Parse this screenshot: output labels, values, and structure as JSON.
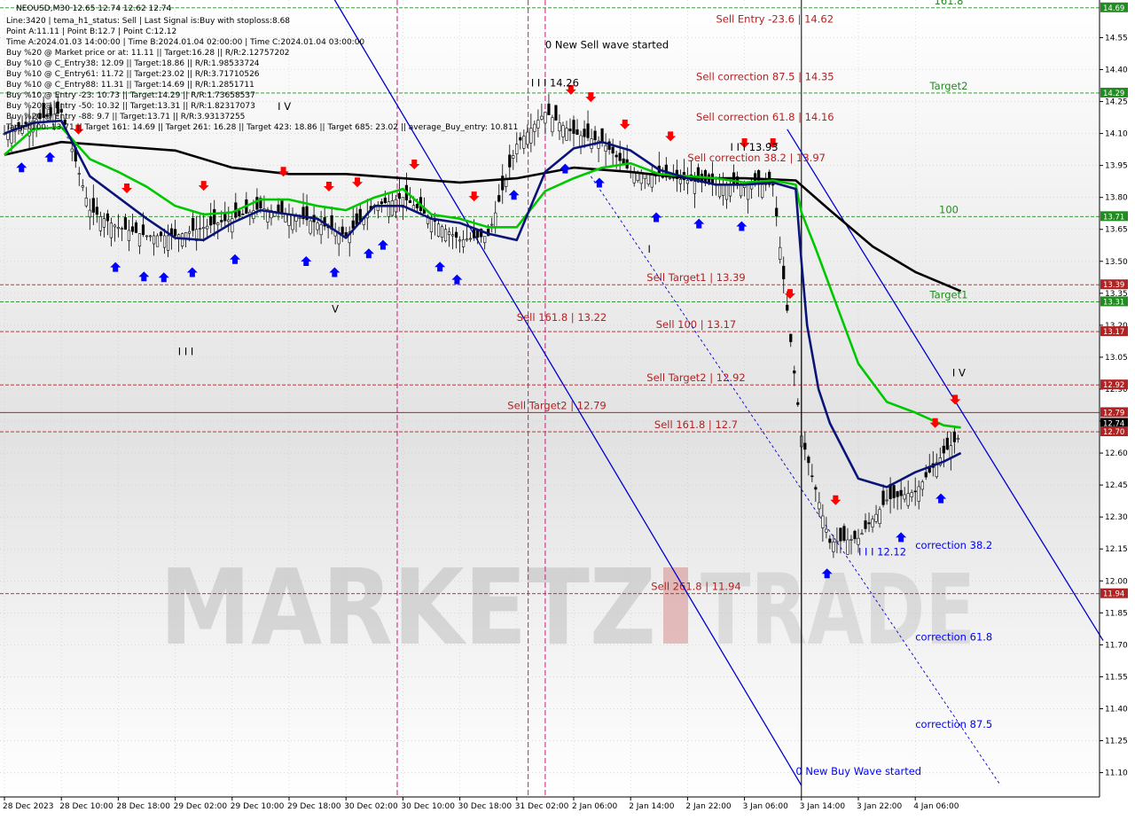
{
  "colors": {
    "background": "#ffffff",
    "plot_bg_top": "#ffffff",
    "plot_bg_mid": "#dedede",
    "grid": "#c8c8c8",
    "candle": "#000000",
    "sell": "#ff0000",
    "sell_level": "#b22222",
    "buy": "#0000ff",
    "green_level": "#228b22",
    "ma_black": "#000000",
    "ma_green": "#00c800",
    "ma_navy": "#0a1478",
    "channel": "#0000cd",
    "vline": "#c81c78",
    "price_badge": "#000000",
    "watermark": "#a0a0a0",
    "watermark_red": "#c03030"
  },
  "header": {
    "symbol_line": "NEOUSD,M30  12.65 12.74 12.62 12.74",
    "info_lines": [
      "Line:3420 | tema_h1_status: Sell | Last Signal is:Buy with stoploss:8.68",
      "Point A:11.11 | Point B:12.7 | Point C:12.12",
      "Time A:2024.01.03 14:00:00 | Time B:2024.01.04 02:00:00 | Time C:2024.01.04 03:00:00",
      "Buy %20 @ Market price or at: 11.11 || Target:16.28 || R/R:2.12757202",
      "Buy %10 @ C_Entry38: 12.09 || Target:18.86 || R/R:1.98533724",
      "Buy %10 @ C_Entry61: 11.72 || Target:23.02 || R/R:3.71710526",
      "Buy %10 @ C_Entry88: 11.31 || Target:14.69 || R/R:1.2851711",
      "Buy %10 @ Entry -23: 10.73 || Target:14.29 || R/R:1.73658537",
      "Buy %20 @ Entry -50: 10.32 || Target:13.31 || R/R:1.82317073",
      "Buy %20 @ Entry -88: 9.7 || Target:13.71 || R/R:3.93137255",
      "Target100: 13.71 || Target 161: 14.69 || Target 261: 16.28 || Target 423: 18.86 || Target 685: 23.02 || average_Buy_entry: 10.811"
    ]
  },
  "price_axis": {
    "ticks": [
      "14.55",
      "14.40",
      "14.25",
      "14.10",
      "13.95",
      "13.80",
      "13.65",
      "13.50",
      "13.35",
      "13.20",
      "13.05",
      "12.90",
      "12.75",
      "12.60",
      "12.45",
      "12.30",
      "12.15",
      "12.00",
      "11.85",
      "11.70",
      "11.55",
      "11.40",
      "11.25",
      "11.10"
    ],
    "highlighted": [
      {
        "value": 14.69,
        "label": "14.69",
        "color": "#228b22"
      },
      {
        "value": 14.29,
        "label": "14.29",
        "color": "#228b22"
      },
      {
        "value": 13.71,
        "label": "13.71",
        "color": "#228b22"
      },
      {
        "value": 13.39,
        "label": "13.39",
        "color": "#b22222"
      },
      {
        "value": 13.31,
        "label": "13.31",
        "color": "#228b22"
      },
      {
        "value": 13.17,
        "label": "13.17",
        "color": "#b22222"
      },
      {
        "value": 12.92,
        "label": "12.92",
        "color": "#b22222"
      },
      {
        "value": 12.79,
        "label": "12.79",
        "color": "#b22222"
      },
      {
        "value": 12.74,
        "label": "12.74",
        "color": "#000000"
      },
      {
        "value": 12.7,
        "label": "12.70",
        "color": "#b22222"
      },
      {
        "value": 11.94,
        "label": "11.94",
        "color": "#b22222"
      }
    ]
  },
  "time_axis": {
    "labels": [
      "28 Dec 2023",
      "28 Dec 10:00",
      "28 Dec 18:00",
      "29 Dec 02:00",
      "29 Dec 10:00",
      "29 Dec 18:00",
      "30 Dec 02:00",
      "30 Dec 10:00",
      "30 Dec 18:00",
      "31 Dec 02:00",
      "2 Jan 06:00",
      "2 Jan 14:00",
      "2 Jan 22:00",
      "3 Jan 06:00",
      "3 Jan 14:00",
      "3 Jan 22:00",
      "4 Jan 06:00"
    ]
  },
  "levels": [
    {
      "value": 14.69,
      "color": "#228b22",
      "style": "dashed",
      "label": "161.8",
      "label_pos": "right"
    },
    {
      "value": 14.29,
      "color": "#228b22",
      "style": "dashed",
      "label": "Target2",
      "label_pos": "right"
    },
    {
      "value": 13.71,
      "color": "#228b22",
      "style": "dashed",
      "label": "100",
      "label_pos": "right"
    },
    {
      "value": 13.39,
      "color": "#b22222",
      "style": "dashed",
      "label": "Sell Target1 | 13.39",
      "label_pos": "center"
    },
    {
      "value": 13.31,
      "color": "#228b22",
      "style": "dashed",
      "label": "Target1",
      "label_pos": "right"
    },
    {
      "value": 13.17,
      "color": "#b22222",
      "style": "dashed",
      "label": "Sell 100 | 13.17",
      "label_pos": "center"
    },
    {
      "value": 12.92,
      "color": "#b22222",
      "style": "dashed",
      "label": "Sell Target2 | 12.92",
      "label_pos": "center"
    },
    {
      "value": 12.79,
      "color": "#b22222",
      "style": "solid",
      "label": "Sell Target2 | 12.79",
      "label_pos": "left"
    },
    {
      "value": 12.7,
      "color": "#b22222",
      "style": "dashed",
      "label": "Sell 161.8 | 12.7",
      "label_pos": "center"
    },
    {
      "value": 11.94,
      "color": "#b22222",
      "style": "dashed",
      "label": "Sell 261.8 | 11.94",
      "label_pos": "center"
    }
  ],
  "annotations": [
    {
      "text": "0 New Sell wave started",
      "time": 19.0,
      "price": 14.5,
      "color": "#000000"
    },
    {
      "text": "I I I 14.26",
      "time": 18.5,
      "price": 14.32,
      "color": "#000000"
    },
    {
      "text": "Sell Entry -23.6 | 14.62",
      "time": 25.0,
      "price": 14.62,
      "color": "#b22222"
    },
    {
      "text": "Sell correction 87.5 | 14.35",
      "time": 24.3,
      "price": 14.35,
      "color": "#b22222"
    },
    {
      "text": "Sell correction 61.8 | 14.16",
      "time": 24.3,
      "price": 14.16,
      "color": "#b22222"
    },
    {
      "text": "Sell correction 38.2 | 13.97",
      "time": 24.0,
      "price": 13.97,
      "color": "#b22222"
    },
    {
      "text": "I I I 13.93",
      "time": 25.5,
      "price": 14.02,
      "color": "#000000"
    },
    {
      "text": "Sell 161.8 | 13.22",
      "time": 18.0,
      "price": 13.22,
      "color": "#b22222"
    },
    {
      "text": "I V",
      "time": 9.6,
      "price": 14.21,
      "color": "#000000"
    },
    {
      "text": "V",
      "time": 11.5,
      "price": 13.26,
      "color": "#000000"
    },
    {
      "text": "I I I",
      "time": 6.1,
      "price": 13.06,
      "color": "#000000"
    },
    {
      "text": "I",
      "time": 22.6,
      "price": 13.54,
      "color": "#000000"
    },
    {
      "text": "I V",
      "time": 33.3,
      "price": 12.96,
      "color": "#000000"
    },
    {
      "text": "I I I 12.12",
      "time": 30.0,
      "price": 12.12,
      "color": "#0000ff"
    },
    {
      "text": "correction 38.2",
      "time": 32.0,
      "price": 12.15,
      "color": "#0000ff"
    },
    {
      "text": "correction 61.8",
      "time": 32.0,
      "price": 11.72,
      "color": "#0000ff"
    },
    {
      "text": "correction 87.5",
      "time": 32.0,
      "price": 11.31,
      "color": "#0000ff"
    },
    {
      "text": "0 New Buy Wave started",
      "time": 27.8,
      "price": 11.09,
      "color": "#0000ff"
    }
  ],
  "watermark": {
    "brand": "MARKETZ",
    "suffix": "TRADE"
  },
  "chart_data": {
    "type": "line",
    "title": "",
    "xlabel": "",
    "ylabel": "",
    "ylim": [
      11.04,
      14.71
    ],
    "x_unit": "bar index (16 bars = one 8-hour label step)",
    "candles_close": {
      "x": [
        0,
        1,
        2,
        3,
        4,
        5,
        6,
        7,
        8,
        9,
        10,
        11,
        12,
        13,
        14,
        15,
        16,
        17,
        18,
        19,
        20,
        21,
        22,
        23,
        24,
        25,
        26,
        27,
        28,
        29,
        30,
        31,
        32,
        33,
        34
      ],
      "price": [
        14.1,
        14.16,
        14.2,
        13.74,
        13.66,
        13.62,
        13.62,
        13.66,
        13.7,
        13.75,
        13.72,
        13.68,
        13.62,
        13.76,
        13.8,
        13.7,
        13.6,
        13.62,
        14.05,
        14.2,
        14.1,
        14.06,
        13.92,
        13.9,
        13.88,
        13.86,
        13.86,
        13.86,
        12.68,
        12.18,
        12.2,
        12.38,
        12.42,
        12.6,
        12.74
      ]
    },
    "series": [
      {
        "color": "#000000",
        "x": [
          0,
          2,
          4,
          6,
          8,
          10,
          12,
          14,
          16,
          18,
          20,
          22,
          24,
          26,
          27.8,
          29,
          30.5,
          32,
          33.6
        ],
        "y": [
          14.0,
          14.06,
          14.04,
          14.02,
          13.94,
          13.91,
          13.91,
          13.89,
          13.87,
          13.89,
          13.94,
          13.92,
          13.89,
          13.89,
          13.88,
          13.74,
          13.57,
          13.45,
          13.36
        ]
      },
      {
        "color": "#00c800",
        "x": [
          0,
          1,
          2,
          3,
          4,
          5,
          6,
          7,
          8,
          9,
          10,
          11,
          12,
          13,
          14,
          15,
          16,
          17,
          18,
          19,
          20,
          21,
          22,
          23,
          24,
          25,
          26,
          27,
          27.8,
          28,
          28.5,
          29,
          30,
          31,
          32,
          33,
          33.6
        ],
        "y": [
          14.0,
          14.12,
          14.13,
          13.98,
          13.92,
          13.85,
          13.76,
          13.72,
          13.73,
          13.79,
          13.79,
          13.76,
          13.74,
          13.8,
          13.84,
          13.72,
          13.7,
          13.66,
          13.66,
          13.83,
          13.89,
          13.94,
          13.96,
          13.91,
          13.9,
          13.89,
          13.87,
          13.88,
          13.86,
          13.73,
          13.56,
          13.38,
          13.02,
          12.84,
          12.79,
          12.73,
          12.72
        ]
      },
      {
        "color": "#0a1478",
        "x": [
          0,
          1,
          2,
          3,
          4,
          5,
          6,
          7,
          8,
          9,
          10,
          11,
          12,
          13,
          14,
          15,
          16,
          17,
          18,
          19,
          20,
          21,
          22,
          23,
          24,
          25,
          26,
          27,
          27.8,
          28,
          28.2,
          28.6,
          29,
          30,
          31,
          32,
          33,
          33.6
        ],
        "y": [
          14.1,
          14.15,
          14.16,
          13.9,
          13.8,
          13.7,
          13.61,
          13.6,
          13.68,
          13.74,
          13.72,
          13.7,
          13.61,
          13.76,
          13.76,
          13.7,
          13.68,
          13.63,
          13.6,
          13.92,
          14.03,
          14.06,
          14.02,
          13.93,
          13.89,
          13.86,
          13.86,
          13.87,
          13.84,
          13.5,
          13.2,
          12.9,
          12.74,
          12.48,
          12.44,
          12.51,
          12.56,
          12.6
        ]
      }
    ],
    "channel_lines": [
      {
        "x": [
          11.5,
          28.0
        ],
        "y": [
          14.75,
          11.04
        ],
        "style": "solid"
      },
      {
        "x": [
          27.5,
          38.6
        ],
        "y": [
          14.12,
          11.72
        ],
        "style": "solid"
      },
      {
        "x": [
          20.5,
          35.0
        ],
        "y": [
          13.92,
          11.04
        ],
        "style": "dotted"
      }
    ],
    "vertical_markers_x": [
      13.8,
      18.4,
      19.0,
      28.0
    ]
  }
}
